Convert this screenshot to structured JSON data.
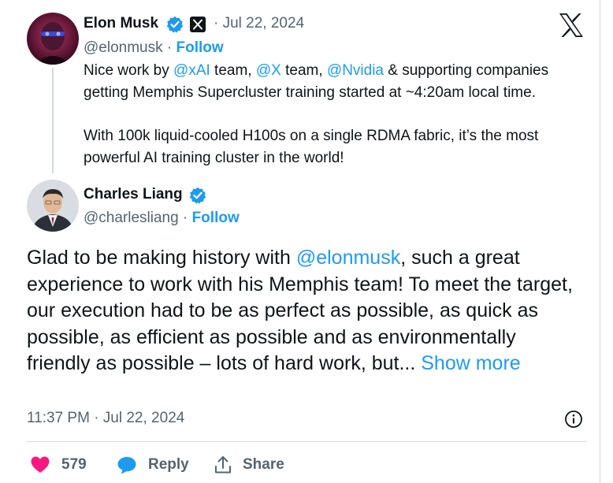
{
  "quoted_tweet": {
    "author_name": "Elon Musk",
    "handle": "@elonmusk",
    "separator": "·",
    "follow_label": "Follow",
    "date": "· Jul 22, 2024",
    "text_1_a": "Nice work by ",
    "mention_1": "@xAI",
    "text_1_b": " team, ",
    "mention_2": "@X",
    "text_1_c": " team, ",
    "mention_3": "@Nvidia",
    "text_1_d": " & supporting companies getting Memphis Supercluster training started at ~4:20am local time.",
    "text_2": "With 100k liquid-cooled H100s on a single RDMA fabric, it’s the most powerful AI training cluster in the world!"
  },
  "reply_tweet": {
    "author_name": "Charles Liang",
    "handle": "@charlesliang",
    "separator": "·",
    "follow_label": "Follow",
    "text_a": "Glad to be making history with ",
    "mention": "@elonmusk",
    "text_b": ", such a great experience to work with his Memphis team! To meet the target, our execution had to be as perfect as possible, as quick as possible, as efficient as possible and as environmentally friendly as possible – lots of hard work, but... ",
    "show_more": "Show more",
    "timestamp": "11:37 PM · Jul 22, 2024"
  },
  "actions": {
    "like_count": "579",
    "reply_label": "Reply",
    "share_label": "Share"
  },
  "colors": {
    "link": "#1d9bf0",
    "like": "#f91880",
    "muted": "#536471",
    "text": "#0f1419"
  },
  "icons": [
    "verified-badge-icon",
    "x-affiliate-badge-icon",
    "x-logo-icon",
    "info-icon",
    "heart-icon",
    "reply-bubble-icon",
    "share-icon"
  ]
}
